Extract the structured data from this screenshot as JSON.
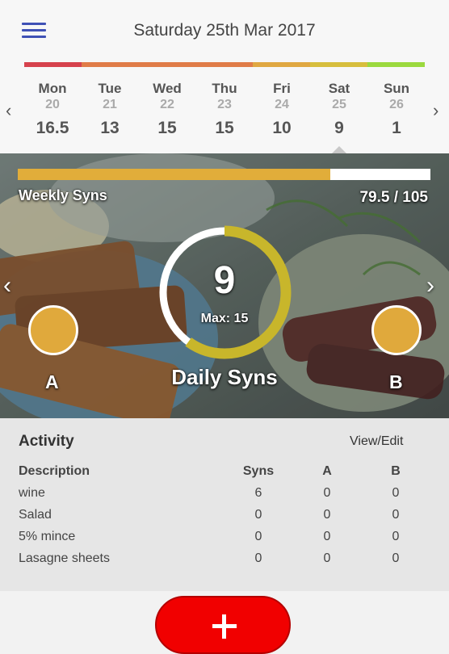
{
  "header": {
    "date_title": "Saturday 25th Mar 2017",
    "menu_icon": "hamburger-menu-icon",
    "color_bar": [
      "#d6424d",
      "#e07c48",
      "#e07c48",
      "#e07c48",
      "#e0a842",
      "#d7be3d",
      "#9bd93e"
    ]
  },
  "week": {
    "prev_icon": "‹",
    "next_icon": "›",
    "selected_index": 5,
    "days": [
      {
        "name": "Mon",
        "date": "20",
        "value": "16.5"
      },
      {
        "name": "Tue",
        "date": "21",
        "value": "13"
      },
      {
        "name": "Wed",
        "date": "22",
        "value": "15"
      },
      {
        "name": "Thu",
        "date": "23",
        "value": "15"
      },
      {
        "name": "Fri",
        "date": "24",
        "value": "10"
      },
      {
        "name": "Sat",
        "date": "25",
        "value": "9"
      },
      {
        "name": "Sun",
        "date": "26",
        "value": "1"
      }
    ]
  },
  "hero": {
    "weekly_label": "Weekly Syns",
    "weekly_value": "79.5 / 105",
    "weekly_progress": 0.757,
    "daily_value": "9",
    "daily_max": "Max: 15",
    "daily_progress": 0.6,
    "daily_label": "Daily Syns",
    "left_arrow": "‹",
    "right_arrow": "›",
    "a_label": "A",
    "b_label": "B",
    "accent": "#e1ad3a",
    "ring_color": "#c8b62b"
  },
  "activity": {
    "title": "Activity",
    "view_edit": "View/Edit",
    "headers": {
      "description": "Description",
      "syns": "Syns",
      "a": "A",
      "b": "B"
    },
    "rows": [
      {
        "description": "wine",
        "syns": "6",
        "a": "0",
        "b": "0"
      },
      {
        "description": "Salad",
        "syns": "0",
        "a": "0",
        "b": "0"
      },
      {
        "description": "5% mince",
        "syns": "0",
        "a": "0",
        "b": "0"
      },
      {
        "description": "Lasagne sheets",
        "syns": "0",
        "a": "0",
        "b": "0"
      }
    ]
  },
  "footer": {
    "add_icon": "plus-icon",
    "add_color": "#f10000"
  }
}
